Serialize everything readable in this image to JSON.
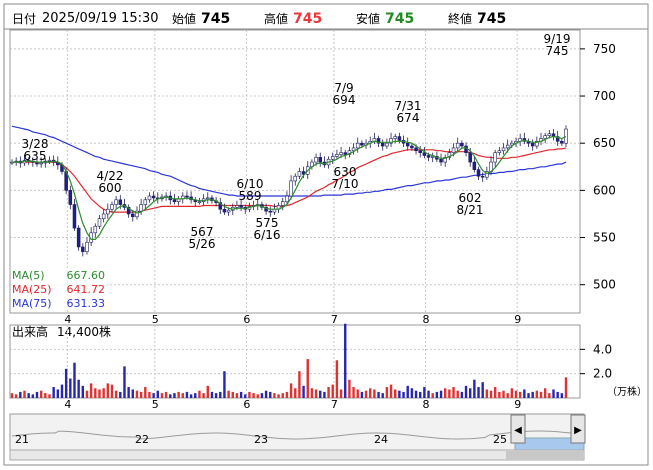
{
  "header": {
    "date_label": "日付",
    "date_value": "2025/09/19 15:30",
    "open_label": "始値",
    "open_value": "745",
    "high_label": "高値",
    "high_value": "745",
    "low_label": "安値",
    "low_value": "745",
    "close_label": "終値",
    "close_value": "745"
  },
  "colors": {
    "ma5": "#2e8b2e",
    "ma25": "#e0282d",
    "ma75": "#2a36d8",
    "volume_up": "#e03030",
    "volume_down": "#2626b0",
    "candle_up_body": "#ffffff",
    "candle_down_body": "#1e1e8c",
    "grid": "#c8c8c8",
    "axis_text": "#000000"
  },
  "legend": {
    "ma5_label": "MA(5)",
    "ma5_value": "667.60",
    "ma25_label": "MA(25)",
    "ma25_value": "641.72",
    "ma75_label": "MA(75)",
    "ma75_value": "631.33"
  },
  "volume_panel": {
    "label": "出来高",
    "value": "14,400株",
    "unit": "（万株）"
  },
  "navigator": {
    "ticks": [
      "21",
      "22",
      "23",
      "24",
      "25"
    ],
    "left_arrow": "◀",
    "right_arrow": "▶"
  },
  "chart_data": {
    "type": "candlestick",
    "price_axis": {
      "ticks": [
        500,
        550,
        600,
        650,
        700,
        750
      ],
      "ylim": [
        470,
        770
      ]
    },
    "month_labels": [
      "4",
      "5",
      "6",
      "7",
      "8",
      "9"
    ],
    "annotations": [
      {
        "date": "3/28",
        "price": "635"
      },
      {
        "date": "4/22",
        "price": "600"
      },
      {
        "date": "5/26",
        "price": "567"
      },
      {
        "date": "6/10",
        "price": "589"
      },
      {
        "date": "6/16",
        "price": "575"
      },
      {
        "date": "7/9",
        "price": "694"
      },
      {
        "date": "7/10",
        "price": "630"
      },
      {
        "date": "7/31",
        "price": "674"
      },
      {
        "date": "8/21",
        "price": "602"
      },
      {
        "date": "9/19",
        "price": "745"
      }
    ],
    "close": [
      630,
      631,
      629,
      632,
      631,
      630,
      628,
      629,
      631,
      632,
      630,
      627,
      620,
      600,
      585,
      560,
      540,
      535,
      545,
      555,
      562,
      570,
      575,
      580,
      585,
      590,
      585,
      582,
      575,
      572,
      578,
      585,
      590,
      594,
      592,
      591,
      593,
      594,
      590,
      588,
      591,
      594,
      593,
      590,
      588,
      588,
      591,
      592,
      589,
      587,
      580,
      577,
      579,
      582,
      584,
      582,
      580,
      583,
      584,
      585,
      582,
      578,
      577,
      580,
      584,
      588,
      594,
      610,
      615,
      620,
      617,
      625,
      630,
      635,
      630,
      627,
      633,
      636,
      638,
      640,
      638,
      642,
      645,
      650,
      648,
      650,
      652,
      655,
      650,
      647,
      650,
      655,
      657,
      653,
      650,
      647,
      645,
      642,
      640,
      637,
      635,
      636,
      633,
      630,
      635,
      640,
      645,
      650,
      647,
      640,
      630,
      622,
      615,
      614,
      620,
      630,
      640,
      642,
      645,
      648,
      650,
      652,
      655,
      652,
      650,
      647,
      652,
      655,
      658,
      660,
      657,
      652,
      650,
      665
    ],
    "ma5": [
      630,
      630,
      630,
      631,
      631,
      631,
      630,
      630,
      630,
      630,
      631,
      630,
      628,
      620,
      610,
      596,
      580,
      565,
      555,
      548,
      548,
      553,
      561,
      568,
      574,
      580,
      583,
      584,
      581,
      578,
      576,
      577,
      580,
      584,
      588,
      591,
      592,
      593,
      592,
      591,
      591,
      591,
      592,
      591,
      590,
      589,
      589,
      590,
      590,
      589,
      586,
      583,
      581,
      580,
      581,
      581,
      581,
      582,
      583,
      584,
      583,
      581,
      580,
      580,
      580,
      582,
      585,
      592,
      600,
      609,
      616,
      621,
      625,
      628,
      629,
      628,
      630,
      631,
      633,
      636,
      637,
      639,
      641,
      644,
      646,
      648,
      650,
      652,
      651,
      651,
      651,
      651,
      652,
      652,
      652,
      651,
      650,
      647,
      644,
      641,
      638,
      637,
      635,
      634,
      634,
      636,
      638,
      641,
      645,
      645,
      642,
      636,
      628,
      621,
      618,
      620,
      624,
      630,
      636,
      642,
      647,
      650,
      652,
      653,
      652,
      651,
      651,
      652,
      654,
      656,
      657,
      656,
      655,
      657
    ],
    "ma25": [
      630,
      630,
      630,
      630,
      630,
      630,
      630,
      630,
      630,
      630,
      630,
      629,
      627,
      624,
      620,
      615,
      609,
      603,
      597,
      591,
      587,
      583,
      580,
      578,
      577,
      577,
      577,
      577,
      577,
      577,
      577,
      578,
      579,
      580,
      581,
      582,
      583,
      583,
      583,
      583,
      583,
      583,
      583,
      583,
      583,
      583,
      584,
      584,
      584,
      584,
      584,
      584,
      584,
      584,
      584,
      584,
      584,
      584,
      584,
      584,
      584,
      584,
      584,
      583,
      583,
      583,
      584,
      585,
      587,
      589,
      591,
      593,
      596,
      599,
      601,
      603,
      606,
      608,
      611,
      613,
      616,
      619,
      621,
      624,
      626,
      628,
      630,
      632,
      634,
      636,
      637,
      639,
      640,
      641,
      642,
      643,
      643,
      643,
      643,
      643,
      643,
      643,
      642,
      642,
      641,
      641,
      641,
      641,
      641,
      641,
      640,
      639,
      637,
      636,
      635,
      635,
      634,
      634,
      634,
      634,
      635,
      635,
      636,
      637,
      638,
      639,
      640,
      641,
      642,
      643,
      643,
      644,
      644,
      645
    ],
    "ma75": [
      668,
      667,
      666,
      665,
      664,
      662,
      661,
      660,
      659,
      657,
      656,
      654,
      652,
      650,
      648,
      646,
      644,
      642,
      640,
      638,
      636,
      635,
      633,
      632,
      631,
      630,
      629,
      628,
      627,
      626,
      625,
      624,
      623,
      621,
      620,
      619,
      617,
      616,
      615,
      613,
      611,
      609,
      607,
      605,
      604,
      602,
      601,
      600,
      599,
      598,
      597,
      596,
      595,
      595,
      594,
      594,
      594,
      594,
      594,
      594,
      594,
      594,
      594,
      594,
      594,
      594,
      594,
      594,
      594,
      594,
      594,
      594,
      594,
      594,
      594,
      595,
      595,
      595,
      595,
      595,
      596,
      596,
      596,
      597,
      597,
      598,
      598,
      599,
      599,
      600,
      601,
      601,
      602,
      603,
      604,
      605,
      605,
      606,
      607,
      608,
      608,
      609,
      610,
      610,
      611,
      611,
      612,
      613,
      614,
      614,
      615,
      616,
      616,
      617,
      617,
      618,
      618,
      619,
      619,
      620,
      620,
      621,
      622,
      622,
      623,
      623,
      624,
      625,
      625,
      626,
      627,
      628,
      628,
      630
    ],
    "volume_axis": {
      "ticks": [
        "2.0",
        "4.0"
      ],
      "ylim": [
        0,
        6
      ]
    },
    "volume": [
      0.4,
      0.3,
      0.5,
      0.6,
      0.4,
      0.3,
      0.5,
      0.6,
      0.4,
      0.3,
      0.9,
      0.7,
      1.1,
      2.4,
      1.6,
      2.9,
      1.5,
      1.0,
      0.6,
      1.2,
      0.8,
      0.7,
      0.8,
      1.2,
      1.1,
      0.6,
      0.5,
      2.6,
      0.9,
      0.7,
      0.6,
      0.5,
      0.9,
      0.5,
      0.4,
      0.6,
      0.4,
      0.5,
      0.3,
      0.4,
      0.5,
      0.4,
      0.5,
      0.3,
      0.4,
      0.6,
      0.4,
      1.0,
      0.5,
      0.4,
      0.5,
      2.2,
      0.6,
      0.5,
      0.4,
      0.5,
      0.3,
      0.5,
      0.4,
      0.3,
      0.4,
      0.6,
      0.5,
      0.4,
      0.3,
      0.4,
      0.5,
      1.2,
      0.8,
      2.2,
      1.0,
      3.2,
      0.8,
      0.7,
      0.6,
      0.5,
      0.9,
      1.1,
      3.1,
      0.7,
      6.1,
      1.5,
      0.9,
      0.7,
      0.5,
      0.6,
      0.8,
      0.7,
      0.5,
      0.4,
      0.9,
      1.1,
      0.7,
      0.6,
      0.5,
      1.0,
      0.8,
      0.6,
      0.5,
      0.9,
      0.6,
      0.4,
      0.5,
      0.6,
      0.8,
      0.7,
      0.9,
      0.6,
      0.5,
      1.0,
      0.8,
      1.5,
      0.9,
      1.3,
      0.7,
      0.6,
      0.9,
      0.5,
      0.6,
      0.4,
      0.8,
      0.6,
      0.5,
      0.7,
      0.4,
      0.5,
      0.6,
      0.5,
      0.8,
      0.4,
      0.7,
      0.5,
      0.4,
      1.7
    ]
  }
}
